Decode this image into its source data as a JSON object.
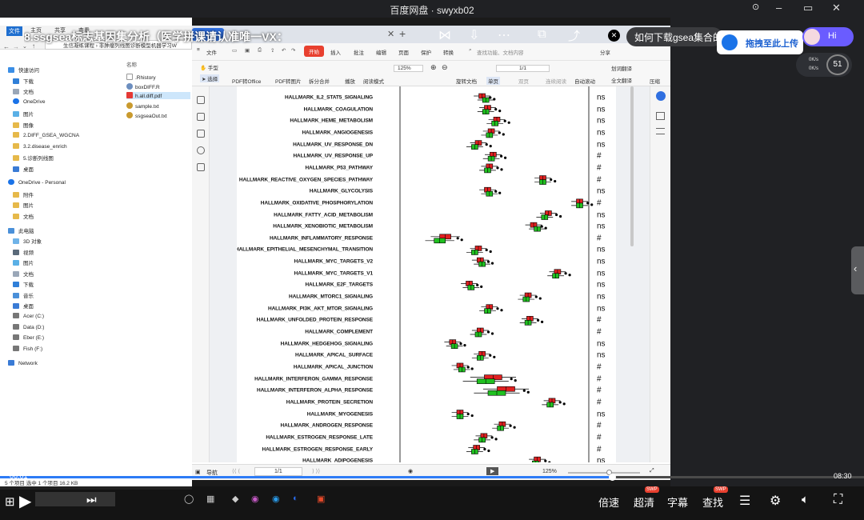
{
  "app": {
    "title": "百度网盘 · swyxb02"
  },
  "video": {
    "overlay_title": "8.ssgsea标志基因集分析（医学拼课请认准唯一VX：",
    "current_time": "06:01",
    "total_time": "08:30",
    "progress": 0.708,
    "controls": {
      "speed": "倍速",
      "quality": "超清",
      "subtitle": "字幕",
      "search": "查找"
    },
    "badges": {
      "quality": "SWP",
      "search": "SWP"
    }
  },
  "promo": {
    "question": "如何下载gsea集合的",
    "upload_label": "拖拽至此上传",
    "hi_label": "Hi"
  },
  "net": {
    "up": "0K/s",
    "down": "0K/s",
    "percent": "51"
  },
  "explorer": {
    "tabs": [
      "文件",
      "主页",
      "共享",
      "查看"
    ],
    "path": "生信凝练课程 › 非肿瘤列线图诊断模型机器学习W",
    "quick_access": "快速访问",
    "nav": [
      "下载",
      "文档",
      "OneDrive",
      "图片",
      "图像",
      "2.DIFF_GSEA_WGCNA",
      "3.2.disease_enrich",
      "5.诊断列线图",
      "桌面"
    ],
    "onedrive_personal": "OneDrive - Personal",
    "od_items": [
      "附件",
      "图片",
      "文档"
    ],
    "this_pc": "此电脑",
    "pc_items": [
      "3D 对象",
      "视频",
      "图片",
      "文档",
      "下载",
      "音乐",
      "桌面",
      "Acer (C:)",
      "Data (D:)",
      "Eber (E:)",
      "Fish (F:)"
    ],
    "network": "Network",
    "col_name": "名称",
    "files": [
      ".Rhistory",
      "boxDIFF.R",
      "h.all.diff.pdf",
      "sample.txt",
      "ssgseaOut.txt"
    ],
    "status": "5 个项目   选中 1 个项目  16.2 KB"
  },
  "pdf": {
    "menu": [
      "文件",
      "开始",
      "插入",
      "批注",
      "编辑",
      "页面",
      "保护",
      "转换"
    ],
    "search_placeholder": "查找功能、文档内容",
    "share": "分享",
    "tools": [
      "手型",
      "选择",
      "PDF转Office",
      "PDF转图片",
      "拆分合并",
      "播放",
      "阅读模式",
      "旋转文档",
      "单页",
      "双页",
      "连续阅读",
      "自动滚动",
      "划词翻译",
      "全文翻译",
      "压缩"
    ],
    "zoom": "125%",
    "page": "1/1",
    "status_nav": "导航",
    "status_page": "1/1",
    "status_zoom": "125%"
  },
  "chart_data": {
    "type": "boxplot",
    "categories": [
      "HALLMARK_IL2_STAT5_SIGNALING",
      "HALLMARK_COAGULATION",
      "HALLMARK_HEME_METABOLISM",
      "HALLMARK_ANGIOGENESIS",
      "HALLMARK_UV_RESPONSE_DN",
      "HALLMARK_UV_RESPONSE_UP",
      "HALLMARK_P53_PATHWAY",
      "HALLMARK_REACTIVE_OXYGEN_SPECIES_PATHWAY",
      "HALLMARK_GLYCOLYSIS",
      "HALLMARK_OXIDATIVE_PHOSPHORYLATION",
      "HALLMARK_FATTY_ACID_METABOLISM",
      "HALLMARK_XENOBIOTIC_METABOLISM",
      "HALLMARK_INFLAMMATORY_RESPONSE",
      "HALLMARK_EPITHELIAL_MESENCHYMAL_TRANSITION",
      "HALLMARK_MYC_TARGETS_V2",
      "HALLMARK_MYC_TARGETS_V1",
      "HALLMARK_E2F_TARGETS",
      "HALLMARK_MTORC1_SIGNALING",
      "HALLMARK_PI3K_AKT_MTOR_SIGNALING",
      "HALLMARK_UNFOLDED_PROTEIN_RESPONSE",
      "HALLMARK_COMPLEMENT",
      "HALLMARK_HEDGEHOG_SIGNALING",
      "HALLMARK_APICAL_SURFACE",
      "HALLMARK_APICAL_JUNCTION",
      "HALLMARK_INTERFERON_GAMMA_RESPONSE",
      "HALLMARK_INTERFERON_ALPHA_RESPONSE",
      "HALLMARK_PROTEIN_SECRETION",
      "HALLMARK_MYOGENESIS",
      "HALLMARK_ANDROGEN_RESPONSE",
      "HALLMARK_ESTROGEN_RESPONSE_LATE",
      "HALLMARK_ESTROGEN_RESPONSE_EARLY",
      "HALLMARK_ADIPOGENESIS"
    ],
    "significance": [
      "ns",
      "ns",
      "ns",
      "ns",
      "ns",
      "#",
      "#",
      "#",
      "ns",
      "#",
      "ns",
      "ns",
      "#",
      "ns",
      "ns",
      "ns",
      "ns",
      "ns",
      "ns",
      "#",
      "#",
      "ns",
      "ns",
      "#",
      "#",
      "#",
      "#",
      "ns",
      "#",
      "#",
      "#",
      "ns"
    ],
    "series": [
      {
        "color": "#e02020",
        "values": [
          0.42,
          0.45,
          0.5,
          0.47,
          0.4,
          0.48,
          0.46,
          0.75,
          0.45,
          0.95,
          0.78,
          0.7,
          0.22,
          0.4,
          0.41,
          0.83,
          0.35,
          0.67,
          0.46,
          0.68,
          0.41,
          0.26,
          0.42,
          0.3,
          0.48,
          0.55,
          0.8,
          0.3,
          0.53,
          0.43,
          0.39,
          0.72
        ]
      },
      {
        "color": "#20c020",
        "values": [
          0.44,
          0.44,
          0.49,
          0.46,
          0.38,
          0.47,
          0.45,
          0.75,
          0.46,
          0.95,
          0.76,
          0.72,
          0.19,
          0.38,
          0.42,
          0.82,
          0.36,
          0.66,
          0.45,
          0.67,
          0.4,
          0.27,
          0.41,
          0.31,
          0.44,
          0.5,
          0.79,
          0.3,
          0.52,
          0.42,
          0.38,
          0.71
        ]
      }
    ]
  }
}
